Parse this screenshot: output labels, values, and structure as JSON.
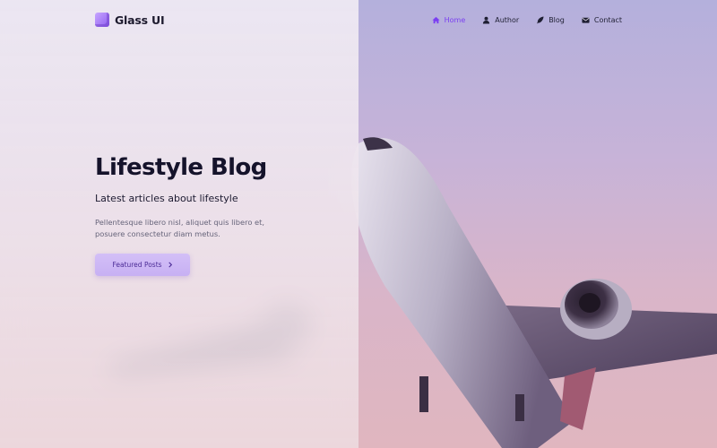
{
  "brand": {
    "name": "Glass UI",
    "icon": "cube-icon"
  },
  "nav": {
    "items": [
      {
        "label": "Home",
        "icon": "home-icon",
        "active": true
      },
      {
        "label": "Author",
        "icon": "user-icon",
        "active": false
      },
      {
        "label": "Blog",
        "icon": "feather-icon",
        "active": false
      },
      {
        "label": "Contact",
        "icon": "envelope-icon",
        "active": false
      }
    ]
  },
  "hero": {
    "title": "Lifestyle Blog",
    "subtitle": "Latest articles about lifestyle",
    "description": "Pellentesque libero nisl, aliquet quis libero et, posuere consectetur diam metus.",
    "cta_label": "Featured Posts"
  },
  "colors": {
    "accent": "#7b3ff2",
    "button_bg": "#cdb8f6",
    "button_text": "#4a2a96",
    "heading": "#15132b",
    "body_text": "#66647a"
  }
}
